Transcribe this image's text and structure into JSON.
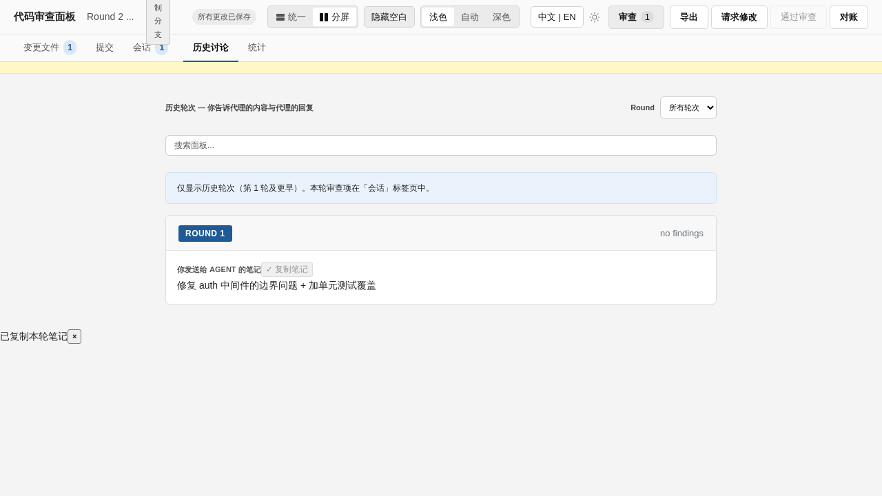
{
  "header": {
    "title": "代码审查面板",
    "subtitle": "Round 2 ...",
    "floating_button": "制分支",
    "save_status": "所有更改已保存",
    "view_modes": [
      {
        "label": "统一",
        "kind": "rows",
        "selected": false
      },
      {
        "label": "分屏",
        "kind": "columns",
        "selected": true
      }
    ],
    "hide_whitespace": {
      "label": "隐藏空白",
      "on": false
    },
    "themes": [
      {
        "label": "浅色",
        "selected": true
      },
      {
        "label": "自动",
        "selected": false
      },
      {
        "label": "深色",
        "selected": false
      }
    ],
    "language": "中文 | EN",
    "actions": [
      {
        "label": "审查",
        "count": "1",
        "kind": "count",
        "disabled": false
      },
      {
        "label": "导出",
        "kind": "plain",
        "disabled": false
      },
      {
        "label": "请求修改",
        "kind": "plain",
        "disabled": false
      },
      {
        "label": "通过审查",
        "kind": "plain",
        "disabled": true
      },
      {
        "label": "对账",
        "kind": "plain",
        "disabled": false
      }
    ]
  },
  "tabs": [
    {
      "label": "变更文件",
      "count": "1",
      "selected": false
    },
    {
      "label": "提交",
      "selected": false
    },
    {
      "label": "会话",
      "count": "1",
      "selected": false
    },
    {
      "label": "历史讨论",
      "selected": true
    },
    {
      "label": "统计",
      "selected": false
    }
  ],
  "history": {
    "heading": "历史轮次 — 你告诉代理的内容与代理的回复",
    "round_filter": {
      "label": "Round",
      "value": "所有轮次"
    },
    "search": {
      "placeholder": "搜索面板..."
    },
    "info": "仅显示历史轮次（第 1 轮及更早）。本轮审查项在「会话」标签页中。",
    "rounds": [
      {
        "badge": "ROUND 1",
        "summary": "no findings",
        "note_label": "你发送给 AGENT 的笔记",
        "copy_button": {
          "label": "✓ 复制笔记",
          "disabled": true
        },
        "note": "修复 auth 中间件的边界问题 + 加单元测试覆盖"
      }
    ]
  },
  "toast": {
    "text": "已复制本轮笔记",
    "close": "×"
  }
}
